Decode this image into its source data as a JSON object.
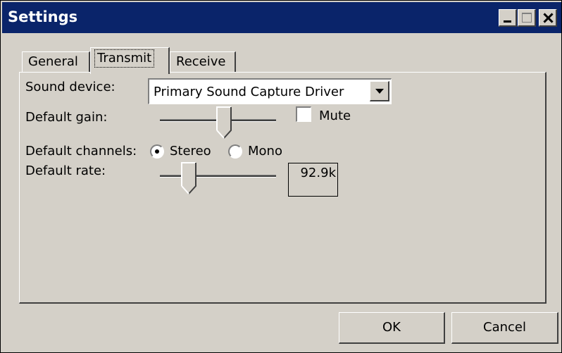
{
  "window": {
    "title": "Settings"
  },
  "tabs": [
    {
      "label": "General",
      "selected": false
    },
    {
      "label": "Transmit",
      "selected": true
    },
    {
      "label": "Receive",
      "selected": false
    }
  ],
  "transmit": {
    "sound_device_label": "Sound device:",
    "sound_device_value": "Primary Sound Capture Driver",
    "default_gain_label": "Default gain:",
    "default_gain_level": 0.55,
    "mute_label": "Mute",
    "mute_checked": false,
    "default_channels_label": "Default channels:",
    "stereo_label": "Stereo",
    "mono_label": "Mono",
    "selected_channel": "Stereo",
    "default_rate_label": "Default rate:",
    "default_rate_level": 0.25,
    "default_rate_value": "92.9k"
  },
  "buttons": {
    "ok_label": "OK",
    "cancel_label": "Cancel"
  },
  "colors": {
    "titlebar": "#0a246a",
    "face": "#d4d0c8"
  }
}
